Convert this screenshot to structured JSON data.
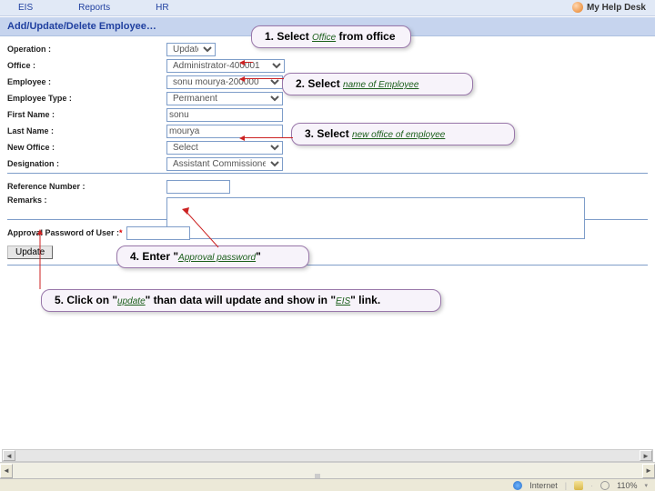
{
  "menu": {
    "eis": "EIS",
    "reports": "Reports",
    "hr": "HR"
  },
  "helpdesk": "My Help Desk",
  "title": "Add/Update/Delete Employee…",
  "form": {
    "operation_label": "Operation :",
    "operation_value": "Update",
    "office_label": "Office :",
    "office_value": "Administrator-400001",
    "employee_label": "Employee :",
    "employee_value": "sonu mourya-200000",
    "emptype_label": "Employee Type :",
    "emptype_value": "Permanent",
    "firstname_label": "First Name :",
    "firstname_value": "sonu",
    "lastname_label": "Last Name :",
    "lastname_value": "mourya",
    "newoffice_label": "New Office :",
    "newoffice_value": "Select",
    "designation_label": "Designation :",
    "designation_value": "Assistant Commissioner",
    "refnum_label": "Reference Number :",
    "remarks_label": "Remarks :",
    "password_label": "Approval Password of User :",
    "asterisk": "*"
  },
  "buttons": {
    "update": "Update"
  },
  "callouts": {
    "c1_pre": "1. Select ",
    "c1_ul": "Office",
    "c1_post": " from office",
    "c2_pre": "2. Select ",
    "c2_ul": "name of Employee",
    "c3_pre": "3. Select ",
    "c3_ul": "new office of employee",
    "c4_pre": "4. Enter \"",
    "c4_ul": "Approval password",
    "c4_post": "\"",
    "c5_pre": "5. Click on \"",
    "c5_ul": "update",
    "c5_mid": "\" than data will update and show in \"",
    "c5_ul2": "EIS",
    "c5_post": "\" link."
  },
  "status": {
    "internet": "Internet",
    "zoom": "110%"
  }
}
